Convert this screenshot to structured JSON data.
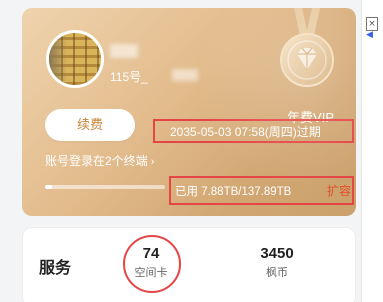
{
  "user": {
    "uid_prefix": "115号_"
  },
  "vip": {
    "title": "年费VIP",
    "renew_label": "续费",
    "expiry": "2035-05-03 07:58(周四)过期",
    "devices_text": "账号登录在2个终端",
    "storage_used_text": "已用 7.88TB/137.89TB",
    "storage_used_fraction": 0.057,
    "expand_label": "扩容"
  },
  "services": {
    "title": "服务",
    "stats": [
      {
        "value": "74",
        "label": "空间卡"
      },
      {
        "value": "3450",
        "label": "枫币"
      }
    ]
  },
  "colors": {
    "accent_red": "#e64545",
    "gold_start": "#efd3ad",
    "gold_end": "#caa06b",
    "expand_orange": "#e0502e",
    "renew_text": "#c7843a"
  },
  "icons": {
    "medal": "vip-medal-icon",
    "chevron": "chevron-right-icon",
    "close": "close-icon"
  }
}
